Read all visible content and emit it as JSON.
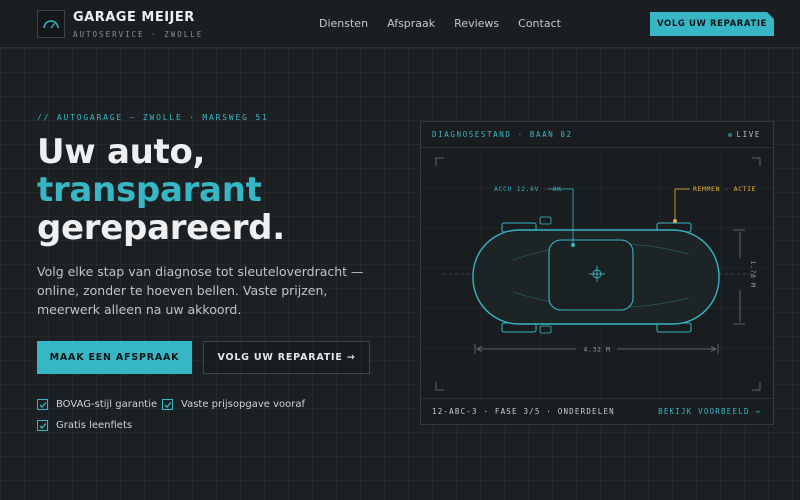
{
  "header": {
    "brand_name": "GARAGE MEIJER",
    "brand_sub": "AUTOSERVICE · ZWOLLE",
    "nav": [
      "Diensten",
      "Afspraak",
      "Reviews",
      "Contact"
    ],
    "cta": "VOLG UW REPARATIE"
  },
  "hero": {
    "eyebrow": "// AUTOGARAGE — ZWOLLE · MARSWEG 51",
    "headline_1": "Uw auto,",
    "headline_2": "transparant",
    "headline_3": "gerepareerd.",
    "lead": "Volg elke stap van diagnose tot sleuteloverdracht — online, zonder te hoeven bellen. Vaste prijzen, meerwerk alleen na uw akkoord.",
    "primary_button": "MAAK EEN AFSPRAAK",
    "secondary_button": "VOLG UW REPARATIE →",
    "checks": [
      "BOVAG-stijl garantie",
      "Vaste prijsopgave vooraf",
      "Gratis leenfiets"
    ]
  },
  "panel": {
    "title": "DIAGNOSESTAND · BAAN 02",
    "live": "LIVE",
    "label_battery": "ACCU 12.6V · OK",
    "label_brakes": "REMMEN · ACTIE",
    "dim_length": "4.32 M",
    "dim_width": "1.78 M",
    "plate": "12-ABC-3 · FASE 3/5 · ONDERDELEN",
    "footer_link": "BEKIJK VOORBEELD →"
  },
  "colors": {
    "accent": "#37b6c6",
    "warning": "#e8b43c",
    "background": "#1d2022"
  }
}
